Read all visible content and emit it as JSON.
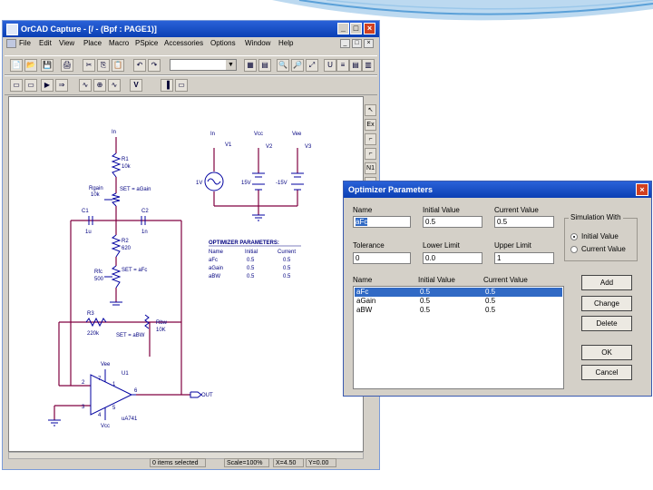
{
  "window": {
    "title": "OrCAD Capture - [/ - (Bpf : PAGE1)]",
    "controls": {
      "minimize": "_",
      "maximize": "□",
      "close": "×"
    },
    "mdi_controls": {
      "minimize": "_",
      "restore": "□",
      "close": "×"
    }
  },
  "menu": [
    "File",
    "Edit",
    "View",
    "Place",
    "Macro",
    "PSpice",
    "Accessories",
    "Options",
    "Window",
    "Help"
  ],
  "toolbar1": [
    "📄",
    "📂",
    "💾",
    "🖨",
    "✂",
    "⎘",
    "📋",
    "↶",
    "↷",
    "",
    "▦",
    "▤",
    "🔍",
    "🔎",
    "⤢",
    "U",
    "≡",
    "▤",
    "▥",
    "▦",
    "▧"
  ],
  "toolbar2": [
    "▭",
    "▭",
    "▶",
    "⇒",
    "∿",
    "⊕",
    "∿",
    "V",
    "▐",
    "▭"
  ],
  "right_tools": [
    "↖",
    "Ex",
    "⌐",
    "⌐",
    "N1",
    "⌐"
  ],
  "status": {
    "items_selected": "0 items selected",
    "scale": "Scale=100%",
    "x": "X=4.50",
    "y": "Y=0.00"
  },
  "schematic": {
    "labels": {
      "in1": "In",
      "r1": "R1",
      "r1v": "10k",
      "rgain": "Rgain",
      "rgain_v": "10k",
      "set_gain": "SET = aGain",
      "c1": "C1",
      "c1v": "1u",
      "c2": "C2",
      "c2v": "1n",
      "r2": "R2",
      "r2v": "620",
      "rfc": "Rfc",
      "rfc_v": "500",
      "set_fc": "SET = aFc",
      "r3": "R3",
      "r3v": "220k",
      "rbw": "Rbw",
      "rbw_v": "10K",
      "set_bw": "SET = aBW",
      "u1": "U1",
      "u1v": "uA741",
      "vcc": "Vcc",
      "vee": "Vee",
      "out": "OUT",
      "src_in": "In",
      "v1": "V1",
      "v_ac": "1V",
      "v2": "V2",
      "v2v": "15V",
      "v3": "V3",
      "v3v": "-15V",
      "vcc_top": "Vcc",
      "vee_top": "Vee",
      "p2": "2",
      "p3": "3",
      "p4": "4",
      "p6": "6",
      "p7": "7",
      "p1": "1",
      "p5": "5"
    },
    "opt_table": {
      "title": "OPTIMIZER PARAMETERS:",
      "headers": [
        "Name",
        "Initial",
        "Current"
      ],
      "rows": [
        [
          "aFc",
          "0.5",
          "0.5"
        ],
        [
          "aGain",
          "0.5",
          "0.5"
        ],
        [
          "aBW",
          "0.5",
          "0.5"
        ]
      ]
    }
  },
  "dialog": {
    "title": "Optimizer Parameters",
    "close": "×",
    "name_label": "Name",
    "name_value": "aFc",
    "initial_label": "Initial Value",
    "initial_value": "0.5",
    "current_label": "Current Value",
    "current_value": "0.5",
    "tolerance_label": "Tolerance",
    "tolerance_value": "0",
    "lower_label": "Lower Limit",
    "lower_value": "0.0",
    "upper_label": "Upper Limit",
    "upper_value": "1",
    "sim_group": "Simulation With",
    "radio_initial": "Initial Value",
    "radio_current": "Current Value",
    "list_headers": [
      "Name",
      "Initial Value",
      "Current Value"
    ],
    "list_rows": [
      [
        "aFc",
        "0.5",
        "0.5"
      ],
      [
        "aGain",
        "0.5",
        "0.5"
      ],
      [
        "aBW",
        "0.5",
        "0.5"
      ]
    ],
    "buttons": {
      "add": "Add",
      "change": "Change",
      "delete": "Delete",
      "ok": "OK",
      "cancel": "Cancel"
    }
  },
  "colors": {
    "titlebar": "#0b3fb4",
    "wire": "#800040",
    "component": "#0000a0",
    "accent_swoosh": "#5aa0d8"
  }
}
